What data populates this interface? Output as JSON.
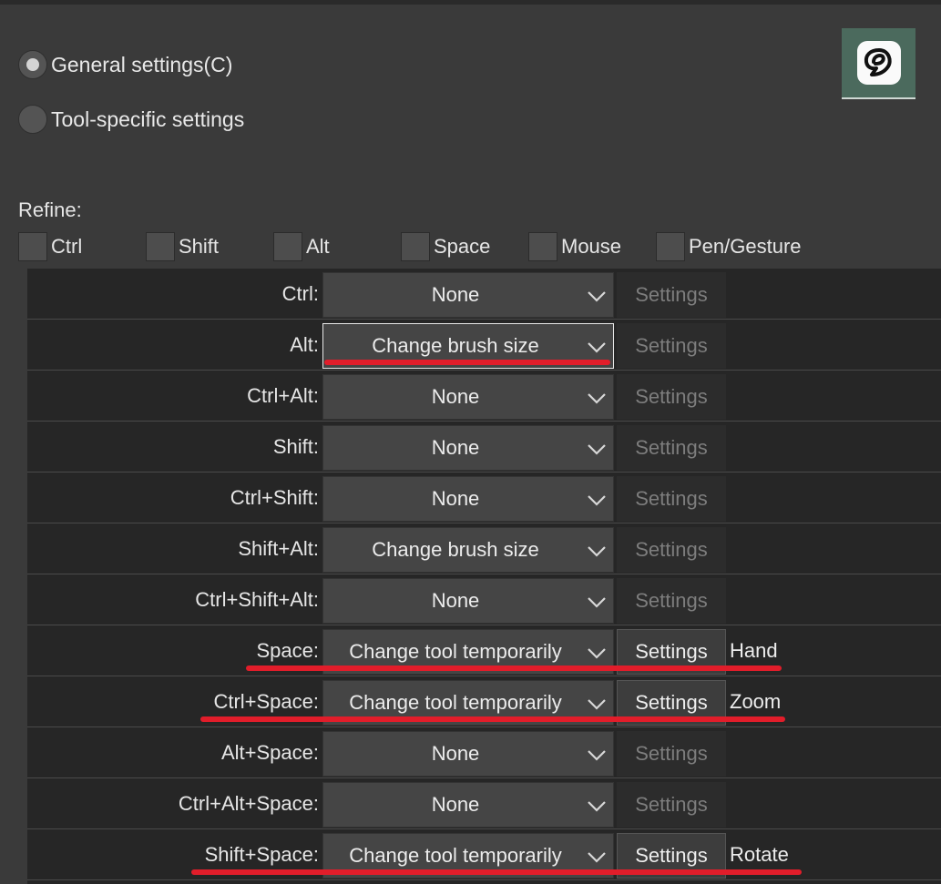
{
  "mode": {
    "options": [
      {
        "label": "General settings(C)",
        "selected": true
      },
      {
        "label": "Tool-specific settings",
        "selected": false
      }
    ]
  },
  "app_icon": {
    "name": "clip-studio-paint-icon"
  },
  "refine": {
    "label": "Refine:",
    "checkboxes": [
      {
        "label": "Ctrl",
        "checked": false
      },
      {
        "label": "Shift",
        "checked": false
      },
      {
        "label": "Alt",
        "checked": false
      },
      {
        "label": "Space",
        "checked": false
      },
      {
        "label": "Mouse",
        "checked": false
      },
      {
        "label": "Pen/Gesture",
        "checked": false
      }
    ]
  },
  "rows": [
    {
      "key": "Ctrl:",
      "value": "None",
      "settings": "Settings",
      "settings_enabled": false,
      "tool": ""
    },
    {
      "key": "Alt:",
      "value": "Change brush size",
      "settings": "Settings",
      "settings_enabled": false,
      "tool": "",
      "focused": true
    },
    {
      "key": "Ctrl+Alt:",
      "value": "None",
      "settings": "Settings",
      "settings_enabled": false,
      "tool": ""
    },
    {
      "key": "Shift:",
      "value": "None",
      "settings": "Settings",
      "settings_enabled": false,
      "tool": ""
    },
    {
      "key": "Ctrl+Shift:",
      "value": "None",
      "settings": "Settings",
      "settings_enabled": false,
      "tool": ""
    },
    {
      "key": "Shift+Alt:",
      "value": "Change brush size",
      "settings": "Settings",
      "settings_enabled": false,
      "tool": ""
    },
    {
      "key": "Ctrl+Shift+Alt:",
      "value": "None",
      "settings": "Settings",
      "settings_enabled": false,
      "tool": ""
    },
    {
      "key": "Space:",
      "value": "Change tool temporarily",
      "settings": "Settings",
      "settings_enabled": true,
      "tool": "Hand"
    },
    {
      "key": "Ctrl+Space:",
      "value": "Change tool temporarily",
      "settings": "Settings",
      "settings_enabled": true,
      "tool": "Zoom"
    },
    {
      "key": "Alt+Space:",
      "value": "None",
      "settings": "Settings",
      "settings_enabled": false,
      "tool": ""
    },
    {
      "key": "Ctrl+Alt+Space:",
      "value": "None",
      "settings": "Settings",
      "settings_enabled": false,
      "tool": ""
    },
    {
      "key": "Shift+Space:",
      "value": "Change tool temporarily",
      "settings": "Settings",
      "settings_enabled": true,
      "tool": "Rotate"
    }
  ],
  "colors": {
    "background": "#3a3a3a",
    "table_background": "#262626",
    "annotation": "#e11d2a",
    "app_icon_background": "#4b6a5d"
  }
}
